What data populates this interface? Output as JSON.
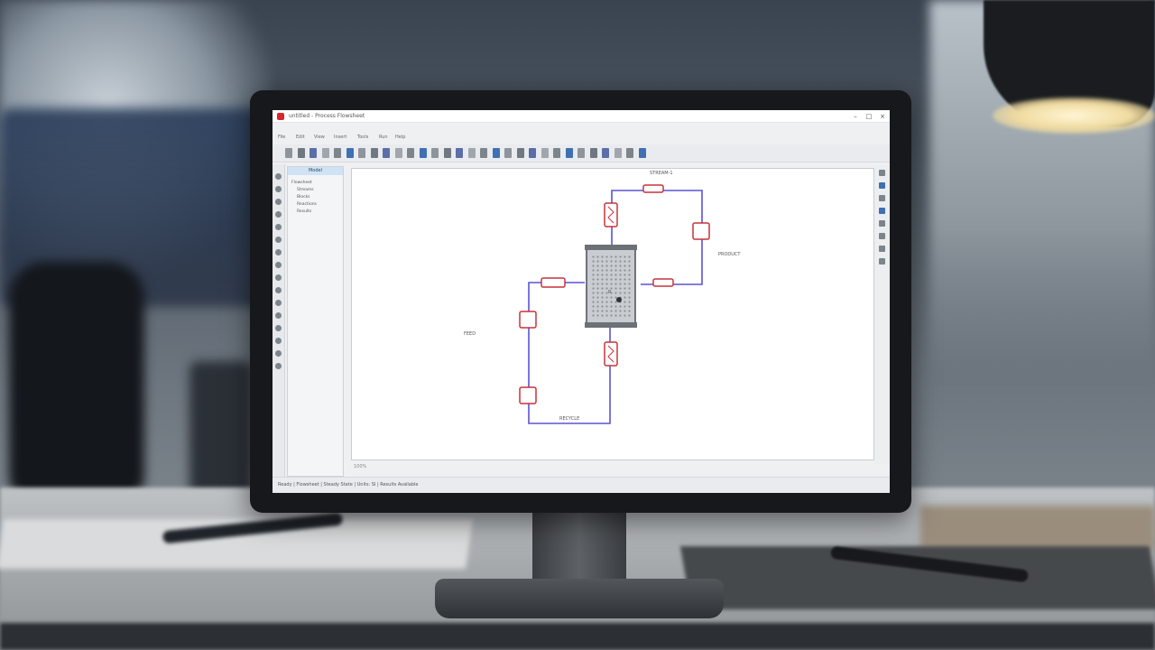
{
  "window": {
    "title": "untitled - Process Flowsheet",
    "minimize": "–",
    "maximize": "□",
    "close": "×"
  },
  "menu": {
    "items": [
      "File",
      "Edit",
      "View",
      "Insert",
      "Tools",
      "Run",
      "Help"
    ]
  },
  "toolbar": {
    "button_count": 30
  },
  "tree": {
    "header": "Model",
    "items": [
      "Flowsheet",
      "Streams",
      "Blocks",
      "Reactions",
      "Results"
    ]
  },
  "canvas": {
    "labels": {
      "top": "STREAM-1",
      "right": "PRODUCT",
      "left": "FEED",
      "bottom": "RECYCLE"
    },
    "reactor_label": "R"
  },
  "status": {
    "text": "Ready  |  Flowsheet  |  Steady State  |  Units: SI  |  Results Available",
    "zoom": "100%"
  },
  "colors": {
    "stream_line": "#5b52d6",
    "unit_outline": "#c8323a",
    "app_accent": "#d9262e"
  }
}
